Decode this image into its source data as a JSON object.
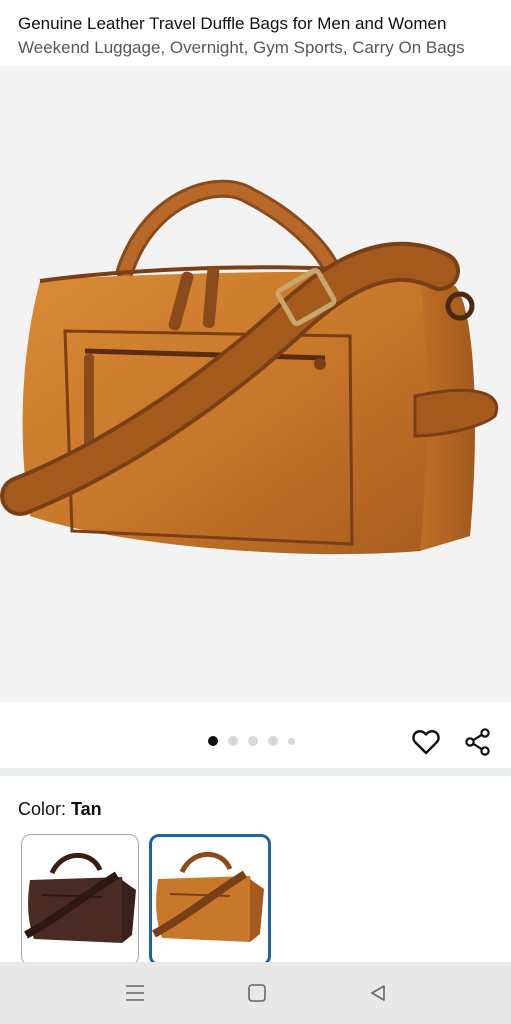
{
  "product": {
    "title": "Genuine Leather Travel Duffle Bags for Men and Women",
    "subtitle": "Weekend Luggage, Overnight, Gym Sports, Carry On Bags"
  },
  "gallery": {
    "image_count": 5,
    "active_index": 0
  },
  "actions": {
    "wishlist_icon": "heart-icon",
    "share_icon": "share-icon"
  },
  "color": {
    "label": "Color: ",
    "selected": "Tan",
    "options": [
      {
        "name": "dark-brown",
        "hex": "#4a2a22"
      },
      {
        "name": "tan",
        "hex": "#c97a2a"
      }
    ]
  },
  "colors": {
    "leather_main": "#c8782a",
    "leather_dark": "#8a4a1c",
    "selected_border": "#2162a1",
    "hero_background": "#f3f3f3"
  },
  "system_nav": {
    "menu_icon": "menu-icon",
    "home_icon": "home-icon",
    "back_icon": "back-icon"
  }
}
